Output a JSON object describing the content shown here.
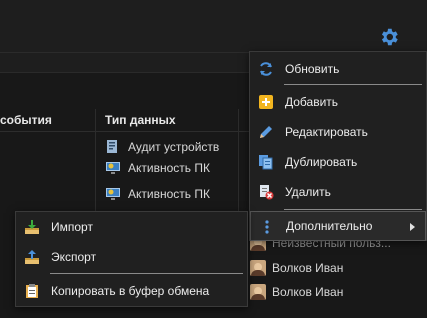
{
  "table": {
    "col_events": "события",
    "col_data_type": "Тип данных",
    "rows": [
      {
        "type": "Аудит устройств"
      },
      {
        "type": "Активность ПК"
      },
      {
        "type": "Активность ПК"
      }
    ],
    "users": [
      {
        "name": "Неизвестный польз..."
      },
      {
        "name": "Волков Иван"
      },
      {
        "name": "Волков Иван"
      }
    ]
  },
  "main_menu": {
    "refresh": "Обновить",
    "add": "Добавить",
    "edit": "Редактировать",
    "duplicate": "Дублировать",
    "delete": "Удалить",
    "more": "Дополнительно"
  },
  "sub_menu": {
    "import": "Импорт",
    "export": "Экспорт",
    "copy": "Копировать в буфер обмена"
  },
  "colors": {
    "accent": "#4a90d9",
    "background": "#1e1e1e",
    "menu_bg": "#202020"
  }
}
